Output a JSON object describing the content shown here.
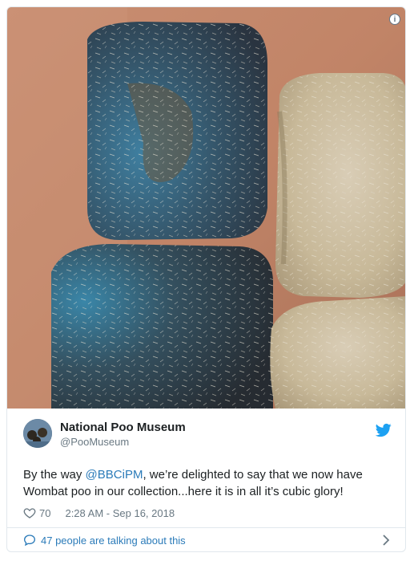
{
  "tweet": {
    "author_name": "National Poo Museum",
    "author_handle": "@PooMuseum",
    "text_before_mention": "By the way ",
    "mention": "@BBCiPM",
    "text_after_mention": ", we’re delighted to say that we now have Wombat poo in our collection...here it is in all it’s cubic glory!",
    "likes": "70",
    "timestamp": "2:28 AM - Sep 16, 2018",
    "conversation_label": "47 people are talking about this",
    "info_icon": "i"
  },
  "icons": {
    "info": "info-icon",
    "bird": "twitter-bird-icon",
    "heart": "heart-icon",
    "bubble": "speech-bubble-icon",
    "chevron": "chevron-right-icon"
  },
  "colors": {
    "link": "#2b7bb9",
    "text": "#1c2022",
    "secondary": "#697882",
    "twitter_blue": "#1da1f2"
  }
}
